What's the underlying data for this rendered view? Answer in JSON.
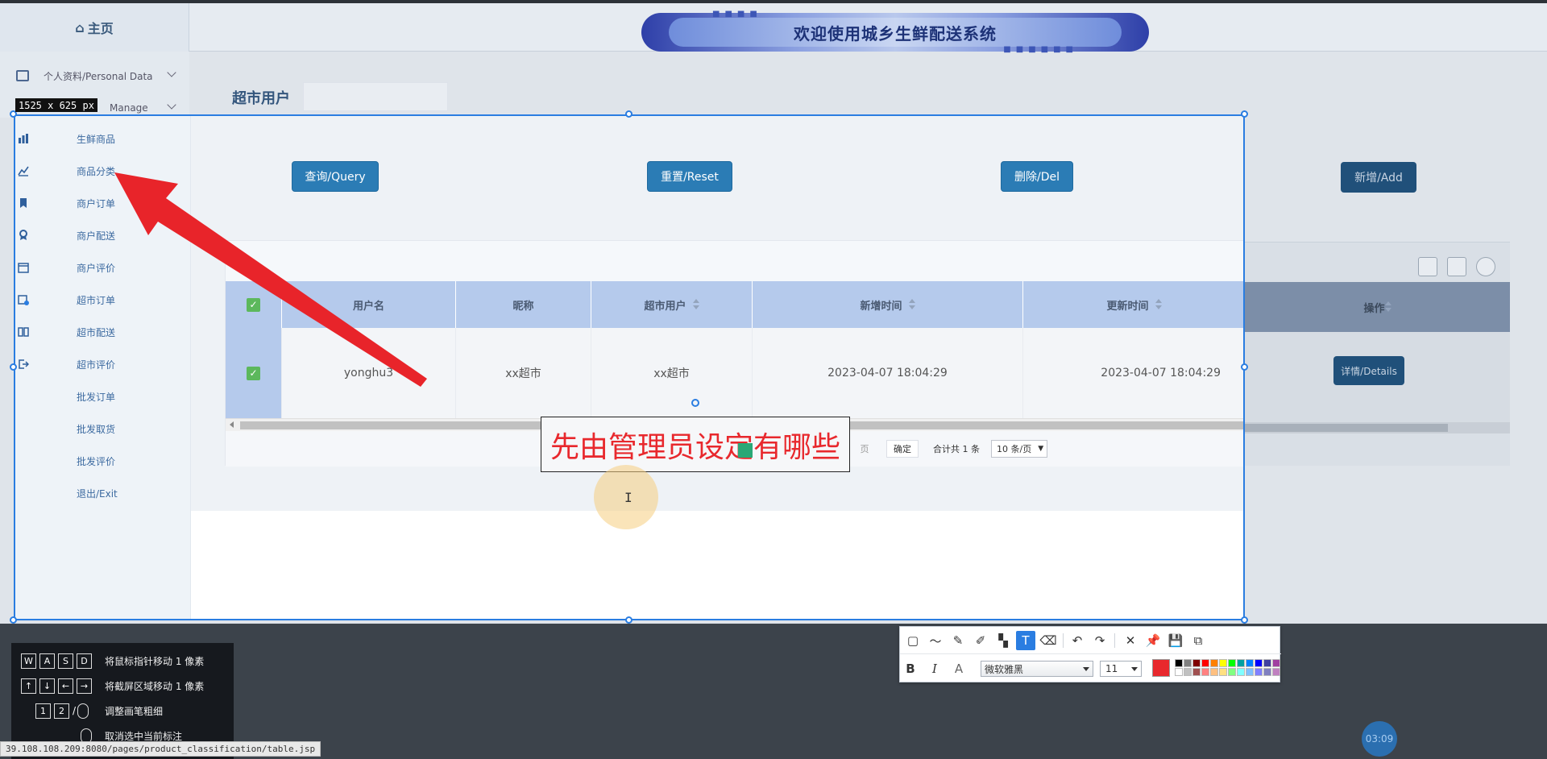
{
  "header": {
    "home_label": "主页",
    "banner_title": "欢迎使用城乡生鲜配送系统"
  },
  "sidebar_top": {
    "personal_data": "个人资料/Personal Data",
    "manage_partial": "Manage"
  },
  "page": {
    "title": "超市用户"
  },
  "sidebar_menu": [
    {
      "label": "生鲜商品",
      "icon": "goods-icon"
    },
    {
      "label": "商品分类",
      "icon": "chart-icon"
    },
    {
      "label": "商户订单",
      "icon": "bookmark-icon"
    },
    {
      "label": "商户配送",
      "icon": "award-icon"
    },
    {
      "label": "商户评价",
      "icon": "calendar-icon"
    },
    {
      "label": "超市订单",
      "icon": "calendar-check-icon"
    },
    {
      "label": "超市配送",
      "icon": "book-icon"
    },
    {
      "label": "超市评价",
      "icon": "exit-icon"
    },
    {
      "label": "批发订单",
      "icon": ""
    },
    {
      "label": "批发取货",
      "icon": ""
    },
    {
      "label": "批发评价",
      "icon": ""
    },
    {
      "label": "退出/Exit",
      "icon": ""
    }
  ],
  "actions": {
    "query": "查询/Query",
    "reset": "重置/Reset",
    "delete": "删除/Del",
    "add": "新增/Add"
  },
  "table": {
    "columns": [
      "用户名",
      "昵称",
      "超市用户",
      "新增时间",
      "更新时间",
      "操作"
    ],
    "rows": [
      {
        "username": "yonghu3",
        "nickname": "xx超市",
        "market": "xx超市",
        "created": "2023-04-07 18:04:29",
        "updated": "2023-04-07 18:04:29",
        "action": "详情/Details"
      }
    ]
  },
  "pager": {
    "page_suffix": "页",
    "confirm": "确定",
    "total": "合计共 1 条",
    "page_size": "10 条/页"
  },
  "annotation": {
    "text": "先由管理员设定有哪些",
    "color": "#e8282d"
  },
  "capture": {
    "size_label": "1525 x 625  px",
    "accent": "#2a7de1"
  },
  "toolbar": {
    "font_name": "微软雅黑",
    "font_size": "11",
    "bold": "B",
    "italic": "I",
    "outline": "A",
    "current_color": "#e8282d",
    "palette": [
      "#000000",
      "#808080",
      "#800000",
      "#ff0000",
      "#ff8000",
      "#ffff00",
      "#00ff00",
      "#00a0a0",
      "#0080ff",
      "#0000ff",
      "#4040a0",
      "#a040a0",
      "#ffffff",
      "#c0c0c0",
      "#a05050",
      "#ff8080",
      "#ffc080",
      "#ffe080",
      "#80ff80",
      "#80ffff",
      "#80c0ff",
      "#8080ff",
      "#8080c0",
      "#c080c0"
    ]
  },
  "help": [
    {
      "keys": [
        "W",
        "A",
        "S",
        "D"
      ],
      "text": "将鼠标指针移动 1 像素"
    },
    {
      "keys": [
        "↑",
        "↓",
        "←",
        "→"
      ],
      "text": "将截屏区域移动 1 像素"
    },
    {
      "keys": [
        "1",
        "2",
        "/"
      ],
      "text": "调整画笔粗细"
    },
    {
      "keys": [],
      "text": "取消选中当前标注"
    }
  ],
  "status": {
    "url": "39.108.108.209:8080/pages/product_classification/table.jsp",
    "timer": "03:09"
  }
}
